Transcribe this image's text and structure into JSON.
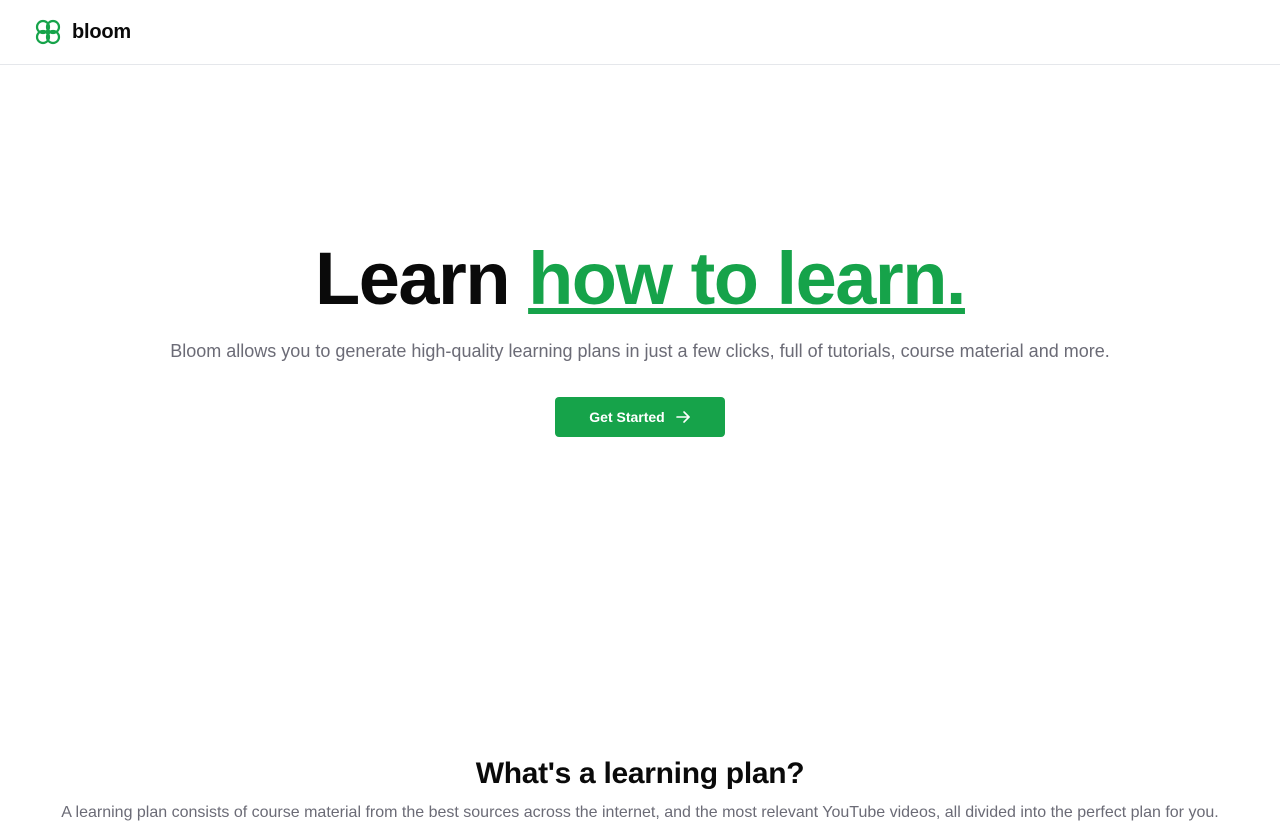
{
  "header": {
    "brand_name": "bloom",
    "logo_icon": "flower-icon"
  },
  "hero": {
    "title_plain": "Learn ",
    "title_accent": "how to learn.",
    "subtitle": "Bloom allows you to generate high-quality learning plans in just a few clicks, full of tutorials, course material and more.",
    "cta_label": "Get Started",
    "cta_icon": "arrow-right-icon"
  },
  "about": {
    "title": "What's a learning plan?",
    "text": "A learning plan consists of course material from the best sources across the internet, and the most relevant YouTube videos, all divided into the perfect plan for you."
  },
  "colors": {
    "accent": "#16a34a",
    "text": "#0a0a0a",
    "muted": "#6b6b76",
    "border": "#e5e7eb"
  }
}
